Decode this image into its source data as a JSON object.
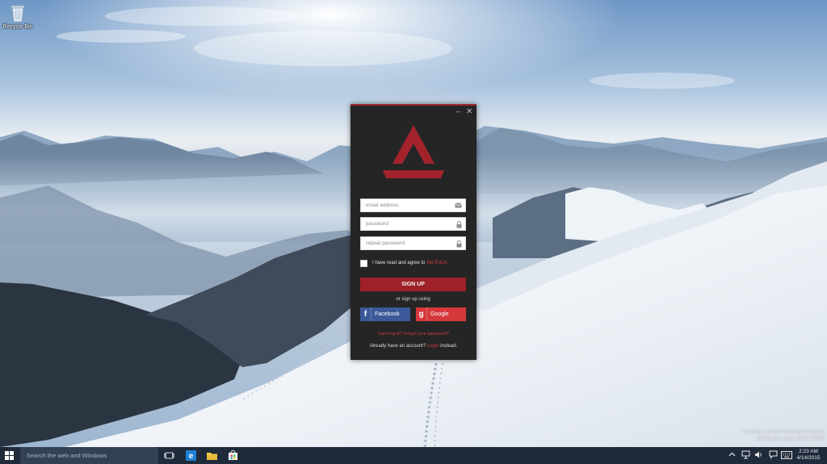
{
  "desktop": {
    "recycle_bin_label": "Recycle Bin"
  },
  "window": {
    "minimize_glyph": "–",
    "close_glyph": "✕",
    "accent_color": "#9e2129",
    "email_placeholder": "email address",
    "password_placeholder": "password",
    "repeat_password_placeholder": "repeat password",
    "agree_text": "I have read and agree to",
    "eula_link": "the EULA",
    "sign_up_label": "SIGN UP",
    "or_text": "or sign up using",
    "facebook_label": "Facebook",
    "facebook_glyph": "f",
    "google_label": "Google",
    "google_glyph": "g",
    "forgot_text": "Can't log in? Forgot your password?",
    "already_text": "Already have an account?",
    "login_link": "Login",
    "instead_text": "instead."
  },
  "watermark": {
    "line1": "Windows 10 Pro Technical Preview",
    "line2": "Evaluation copy. Build 10049"
  },
  "taskbar": {
    "search_placeholder": "Search the web and Windows",
    "time": "2:23 AM",
    "date": "4/14/2015",
    "icons": [
      "windows-icon",
      "task-view-icon",
      "edge-icon",
      "file-explorer-icon",
      "store-icon"
    ],
    "tray_icons": [
      "chevron-up-icon",
      "network-icon",
      "volume-icon",
      "notification-icon",
      "keyboard-icon"
    ]
  }
}
